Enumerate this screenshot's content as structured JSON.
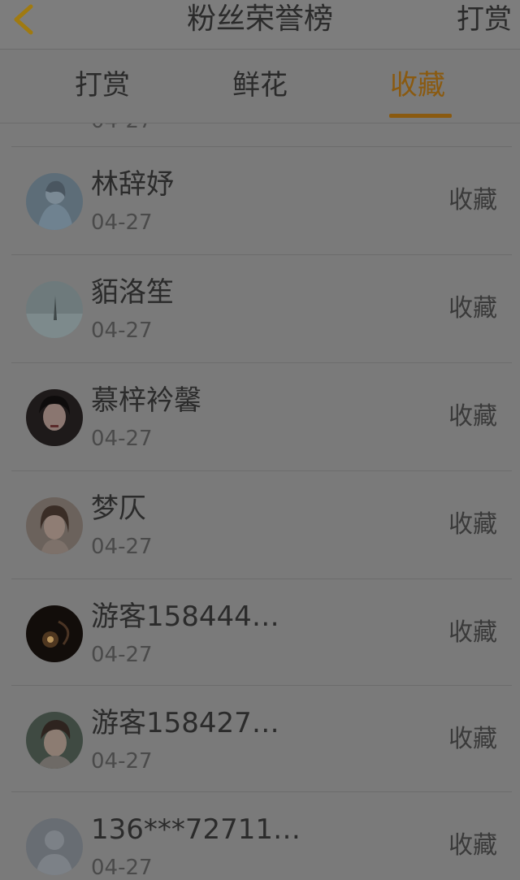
{
  "header": {
    "title": "粉丝荣誉榜",
    "right_label": "打赏",
    "back_icon": "chevron-left-icon",
    "back_color": "#a07a10"
  },
  "tabs": [
    {
      "label": "打赏",
      "active": false
    },
    {
      "label": "鲜花",
      "active": false
    },
    {
      "label": "收藏",
      "active": true
    }
  ],
  "colors": {
    "accent": "#8a5a10",
    "overlay_bg": "#7a7a7a"
  },
  "list": {
    "partial_top_date": "04-27",
    "items": [
      {
        "name": "林辞妤",
        "date": "04-27",
        "action": "收藏",
        "avatar": "avatar-girl-blue-icon"
      },
      {
        "name": "貊洛笙",
        "date": "04-27",
        "action": "收藏",
        "avatar": "avatar-landscape-icon"
      },
      {
        "name": "慕梓衿馨",
        "date": "04-27",
        "action": "收藏",
        "avatar": "avatar-girl-dark-hair-icon"
      },
      {
        "name": "梦仄",
        "date": "04-27",
        "action": "收藏",
        "avatar": "avatar-girl-portrait-icon"
      },
      {
        "name": "游客158444…",
        "date": "04-27",
        "action": "收藏",
        "avatar": "avatar-light-flare-icon"
      },
      {
        "name": "游客158427…",
        "date": "04-27",
        "action": "收藏",
        "avatar": "avatar-boy-portrait-icon"
      },
      {
        "name": "136***72711…",
        "date": "04-27",
        "action": "收藏",
        "avatar": "avatar-default-user-icon"
      }
    ]
  }
}
